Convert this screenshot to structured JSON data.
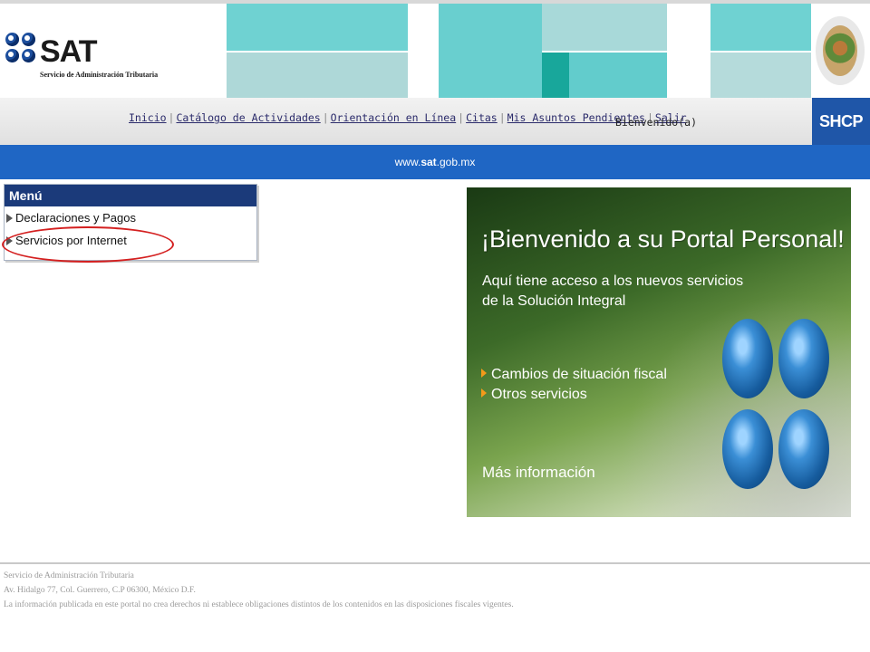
{
  "header": {
    "logo_text": "SAT",
    "logo_subtitle": "Servicio de Administración Tributaria",
    "tile_colors": [
      "#6fd2d2",
      "#aed8d8",
      "#69cfcf",
      "#a8d9d9",
      "#18a79b",
      "#62cccc",
      "#b5dbdb"
    ]
  },
  "nav": {
    "links": [
      {
        "label": "Inicio"
      },
      {
        "label": "Catálogo de Actividades"
      },
      {
        "label": "Orientación en Línea"
      },
      {
        "label": "Citas"
      },
      {
        "label": "Mis Asuntos Pendientes"
      },
      {
        "label": "Salir"
      }
    ],
    "welcome": "Bienvenido(a)",
    "shcp_label": "SHCP"
  },
  "urlbar": {
    "prefix": "www.",
    "bold": "sat",
    "suffix": ".gob.mx"
  },
  "menu": {
    "title": "Menú",
    "items": [
      {
        "label": "Declaraciones y Pagos"
      },
      {
        "label": "Servicios por Internet"
      }
    ]
  },
  "banner": {
    "title": "¡Bienvenido a su Portal Personal!",
    "line1": "Aquí tiene acceso a los nuevos servicios",
    "line2": "de la Solución Integral",
    "bullets": [
      "Cambios de situación fiscal",
      "Otros servicios"
    ],
    "more": "Más información",
    "bullet_color": "#f39a1a"
  },
  "footer": {
    "line1": "Servicio de Administración Tributaria",
    "line2": "Av. Hidalgo 77, Col. Guerrero, C.P 06300, México D.F.",
    "line3": "La información publicada en este portal no crea derechos ni establece obligaciones distintos de los contenidos en las disposiciones fiscales vigentes."
  },
  "colors": {
    "nav_blue": "#1f66c4",
    "menu_header": "#1b3a7a",
    "highlight_red": "#d42020"
  }
}
